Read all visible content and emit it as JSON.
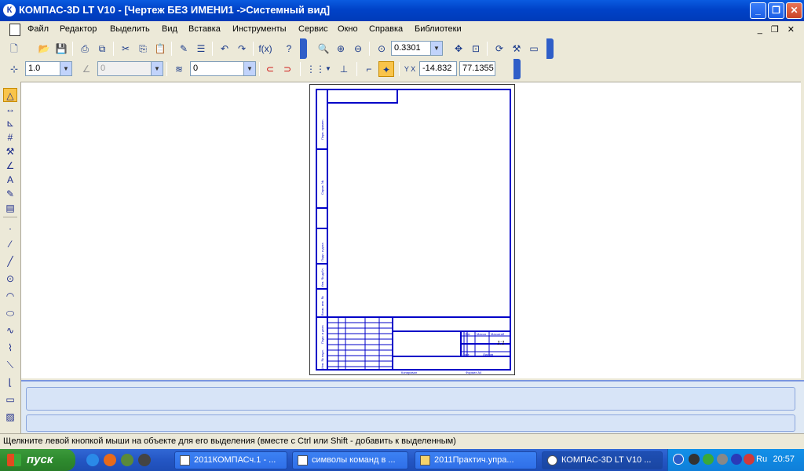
{
  "window": {
    "title": "КОМПАС-3D LT V10 - [Чертеж БЕЗ ИМЕНИ1 ->Системный вид]",
    "app_icon": "К"
  },
  "menu": {
    "items": [
      "Файл",
      "Редактор",
      "Выделить",
      "Вид",
      "Вставка",
      "Инструменты",
      "Сервис",
      "Окно",
      "Справка",
      "Библиотеки"
    ]
  },
  "toolbar1": {
    "zoom_value": "0.3301"
  },
  "toolbar2": {
    "step_value": "1.0",
    "angle_value": "0",
    "layer_value": "0",
    "coord_label": "Y X",
    "coord_x": "-14.832",
    "coord_y": "77.1355"
  },
  "drawing": {
    "stamp_sheet_label": "Лист",
    "stamp_sheets_label": "Листов",
    "stamp_mass_label": "Масса",
    "stamp_scale_label": "Масштаб",
    "stamp_scale_value": "1:1",
    "copied_label": "Копировал",
    "format_label": "Формат А4",
    "side_labels": [
      "Перв. примен.",
      "Справ. №",
      "Подп. и дата",
      "Инв. № дубл.",
      "Взам. инв. №",
      "Подп. и дата",
      "Инв. № подл."
    ]
  },
  "statusbar": {
    "text": "Щелкните левой кнопкой мыши на объекте для его выделения (вместе с Ctrl или Shift - добавить к выделенным)"
  },
  "taskbar": {
    "start_label": "пуск",
    "tasks": [
      "2011КОМПАСч.1 - ...",
      "символы команд в ...",
      "2011Практич.упра...",
      "КОМПАС-3D LT V10 ..."
    ],
    "lang": "Ru",
    "clock": "20:57"
  }
}
